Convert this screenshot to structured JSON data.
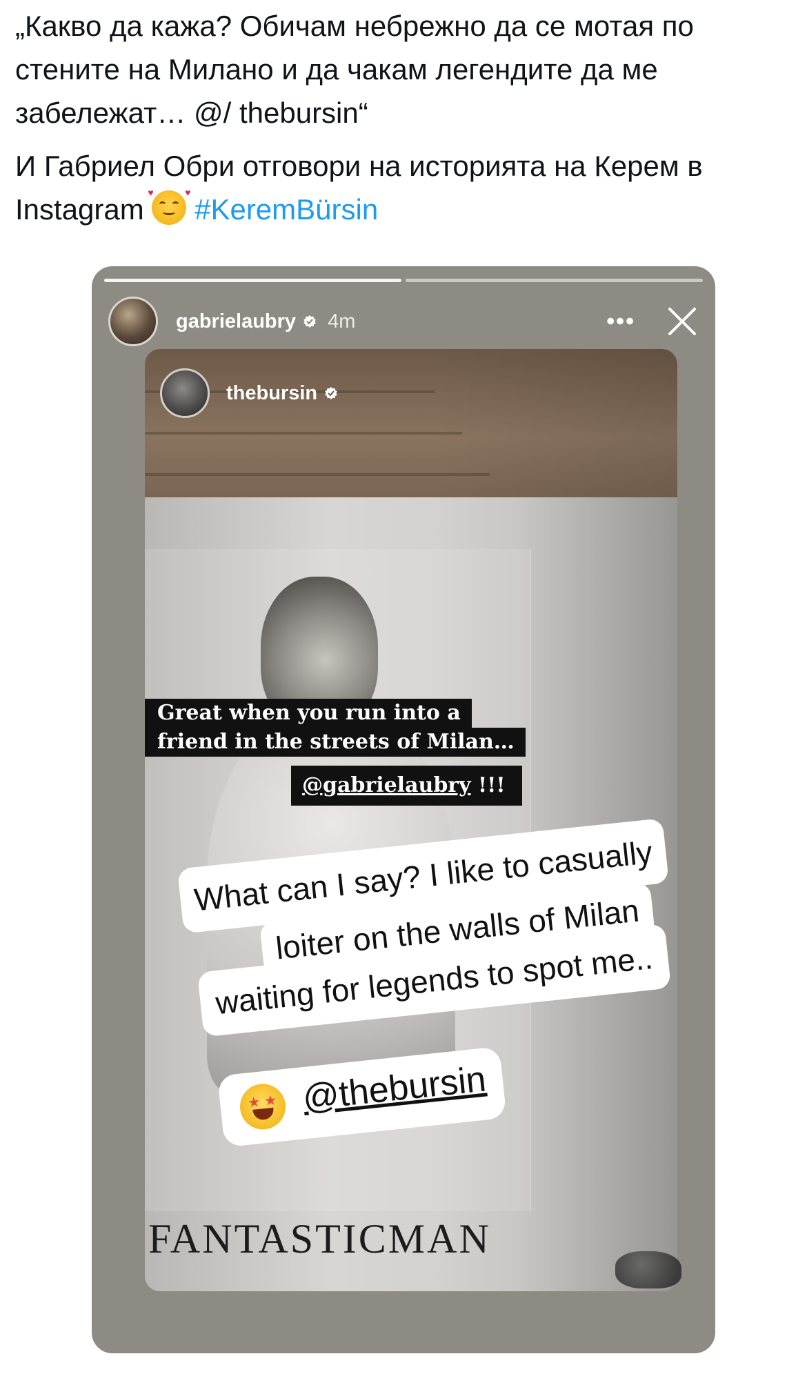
{
  "tweet": {
    "paragraph1": "„Какво да кажа? Обичам небрежно да се мотая по стените на Милано и да чакам легендите да ме забележат… @/ thebursin“",
    "paragraph2_text": "И Габриел Обри отговори на историята на Керем в Instagram",
    "hashtag": "#KeremBürsin",
    "emoji_icon": "smiling-face-with-hearts-icon"
  },
  "story": {
    "username": "gabrielaubry",
    "time": "4m",
    "more_icon": "more-dots-icon",
    "close_icon": "close-icon",
    "progress_segments": 2,
    "shared": {
      "username": "thebursin",
      "caption_line1": "Great when you run into a",
      "caption_line2": "friend in the streets of Milan…",
      "caption_mention": "@gabrielaubry",
      "caption_suffix": " !!!",
      "poster_brand": "FANTASTICMAN"
    },
    "reply": {
      "line1": "What can I say? I like to casually",
      "line2": "loiter on the walls of Milan",
      "line3": "waiting for legends to spot me..",
      "mention": "@thebursin",
      "emoji_icon": "star-struck-icon"
    }
  }
}
